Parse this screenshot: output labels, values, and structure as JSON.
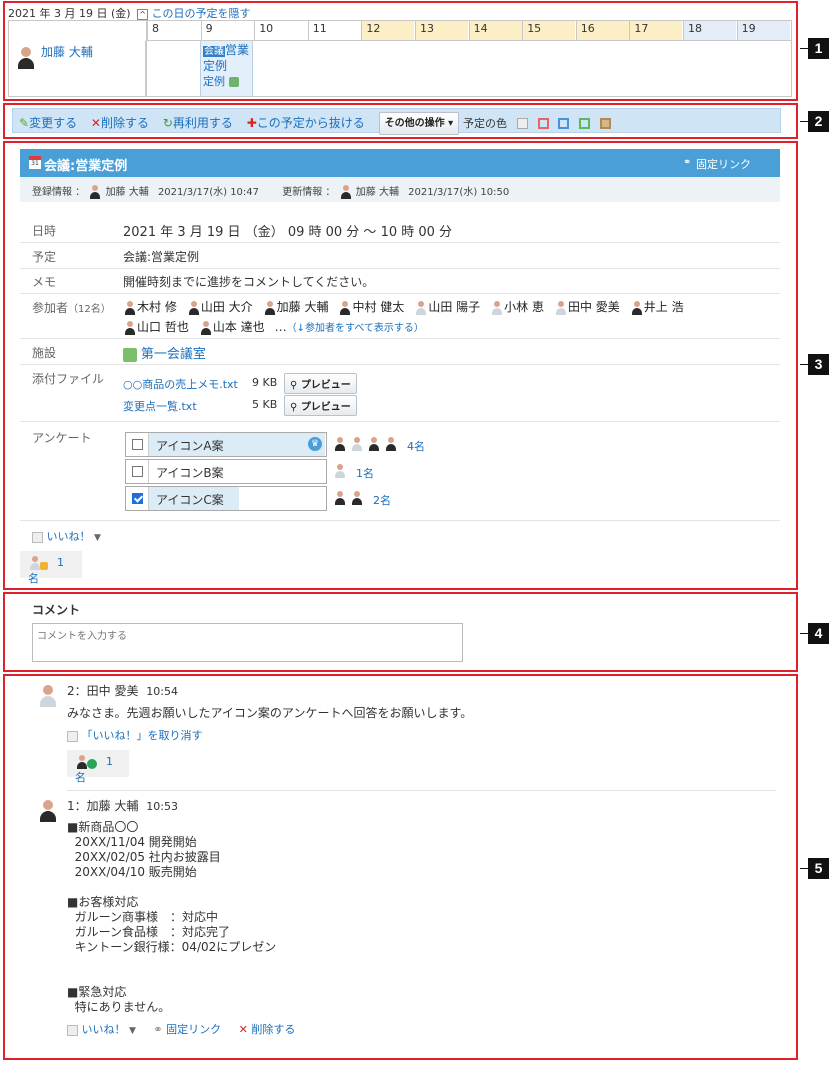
{
  "timeline": {
    "date": "2021 年 3 月 19 日 (金)",
    "hide_link": "この日の予定を隠す",
    "hours": [
      "8",
      "9",
      "10",
      "11",
      "12",
      "13",
      "14",
      "15",
      "16",
      "17",
      "18",
      "19"
    ],
    "user": "加藤 大輔",
    "event_badge": "会議",
    "event_title": "営業定例"
  },
  "toolbar": {
    "edit": "変更する",
    "delete": "削除する",
    "reuse": "再利用する",
    "leave": "この予定から抜ける",
    "more": "その他の操作",
    "color_label": "予定の色"
  },
  "detail": {
    "title": "会議:営業定例",
    "permalink": "固定リンク",
    "reg_label": "登録情報 ：",
    "reg_user": "加藤 大輔",
    "reg_time": "2021/3/17(水) 10:47",
    "upd_label": "更新情報 ：",
    "upd_user": "加藤 大輔",
    "upd_time": "2021/3/17(水) 10:50",
    "date_label": "日時",
    "date_value": "2021 年 3 月 19 日 （金） 09 時 00 分 ～ 10 時 00 分",
    "plan_label": "予定",
    "plan_value": "会議:営業定例",
    "memo_label": "メモ",
    "memo_value": "開催時刻までに進捗をコメントしてください。",
    "part_label": "参加者",
    "part_count": "（12名）",
    "participants": [
      "木村 修",
      "山田 大介",
      "加藤 大輔",
      "中村 健太",
      "山田 陽子",
      "小林 恵",
      "田中 愛美",
      "井上 浩",
      "山口 哲也",
      "山本 達也"
    ],
    "part_more": "…",
    "part_show_all": "（↓参加者をすべて表示する）",
    "fac_label": "施設",
    "facility": "第一会議室",
    "att_label": "添付ファイル",
    "files": [
      {
        "name": "○○商品の売上メモ.txt",
        "size": "9 KB"
      },
      {
        "name": "変更点一覧.txt",
        "size": "5 KB"
      }
    ],
    "preview": "プレビュー",
    "survey_label": "アンケート",
    "survey": [
      {
        "option": "アイコンA案",
        "count": "4名"
      },
      {
        "option": "アイコンB案",
        "count": "1名"
      },
      {
        "option": "アイコンC案",
        "count": "2名"
      }
    ],
    "like": "いいね！",
    "like_count": "1名"
  },
  "comment_box": {
    "heading": "コメント",
    "placeholder": "コメントを入力する"
  },
  "comments": [
    {
      "header": "2：田中 愛美",
      "time": "10:54",
      "text": "みなさま。先週お願いしたアイコン案のアンケートへ回答をお願いします。",
      "unlike": "「いいね！」を取り消す",
      "like_count": "1名"
    },
    {
      "header": "1：加藤 大輔",
      "time": "10:53",
      "lines": [
        "■新商品〇〇",
        "  20XX/11/04 開発開始",
        "  20XX/02/05 社内お披露目",
        "  20XX/04/10 販売開始",
        "",
        "■お客様対応",
        "  ガルーン商事様　：対応中",
        "  ガルーン食品様　：対応完了",
        "  キントーン銀行様：04/02にプレゼン",
        "",
        "",
        "■緊急対応",
        "  特にありません。"
      ],
      "like": "いいね！",
      "permalink": "固定リンク",
      "delete": "削除する"
    }
  ],
  "markers": [
    "1",
    "2",
    "3",
    "4",
    "5"
  ],
  "colors": {
    "accent": "#1a6fbd",
    "header_blue": "#4a9fd6",
    "callout": "#e0212a"
  }
}
